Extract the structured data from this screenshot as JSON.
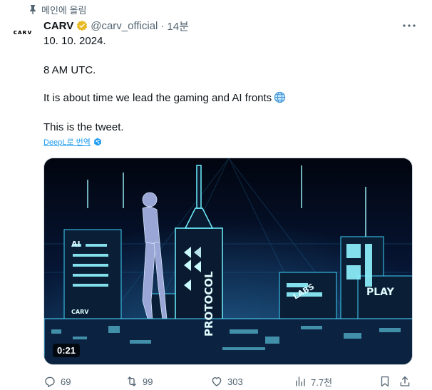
{
  "pinned_label": "메인에 올림",
  "author": {
    "avatar_text": "ᴄᴀʀᴠ",
    "name": "CARV",
    "handle": "@carv_official",
    "separator": "·",
    "time": "14분"
  },
  "tweet": {
    "lines": [
      "10. 10. 2024.",
      "8 AM UTC.",
      "It is about time we lead the gaming and AI fronts",
      "This is the tweet."
    ]
  },
  "translate_label": "DeepL로 번역",
  "media": {
    "duration": "0:21",
    "signs": {
      "ai": "AI",
      "protocol": "PROTOCOL",
      "labs": "LABS",
      "play": "PLAY",
      "carv_small": "CARV"
    }
  },
  "actions": {
    "replies": "69",
    "reposts": "99",
    "likes": "303",
    "views": "7.7천"
  },
  "colors": {
    "accent": "#1d9bf0",
    "verified": "#e8b923",
    "neon": "#7ff3ff"
  }
}
